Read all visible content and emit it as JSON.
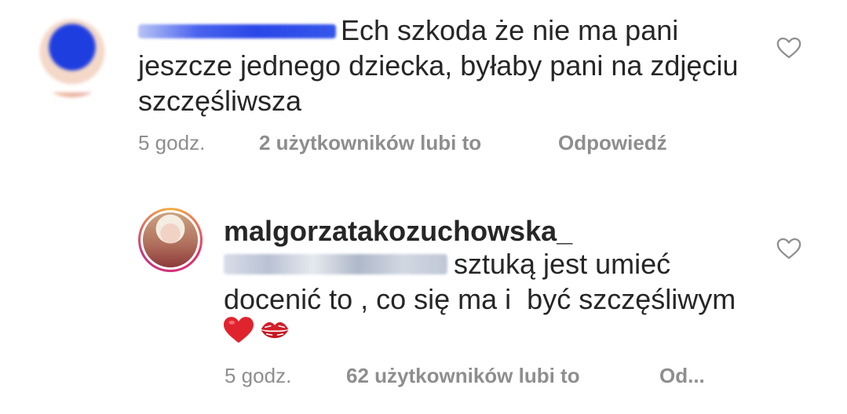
{
  "comments": [
    {
      "text_line1": "Ech szkoda że nie ma pani",
      "text_line2": "jeszcze jednego dziecka, byłaby pani na zdjęciu",
      "text_line3": "szczęśliwsza",
      "time": "5 godz.",
      "likes": "2 użytkowników lubi to",
      "reply": "Odpowiedź",
      "username_blurred_color": "#2a47e8",
      "avatar_icon": "avatar-blurred"
    },
    {
      "username": "malgorzatakozuchowska_",
      "text_line1": "sztuką jest umieć",
      "text_line2": "docenić to , co się ma i  być szczęśliwym",
      "emoji_heart": "heart-emoji",
      "emoji_kiss": "kiss-mark-emoji",
      "time": "5 godz.",
      "likes": "62 użytkowników lubi to",
      "reply": "Od..."
    }
  ],
  "icons": {
    "like": "heart-outline-icon"
  },
  "colors": {
    "text": "#262626",
    "meta": "#8e8e8e",
    "heart_emoji": "#e0242e",
    "kiss_emoji": "#d21f2a"
  }
}
